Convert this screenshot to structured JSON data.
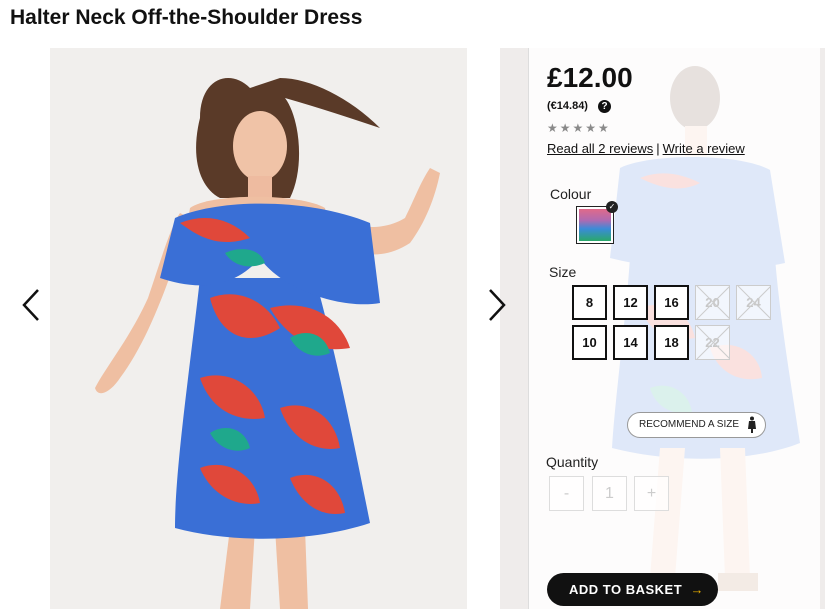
{
  "product": {
    "title": "Halter Neck Off-the-Shoulder Dress",
    "price": "£12.00",
    "price_alt": "(€14.84)",
    "help_icon": "?",
    "stars": "★★★★★",
    "rating": 0,
    "read_reviews": "Read all 2 reviews",
    "separator": "|",
    "write_review": "Write a review"
  },
  "gallery": {
    "prev_icon": "chevron-left-icon",
    "next_icon": "chevron-right-icon"
  },
  "colour": {
    "label": "Colour",
    "selected_check": "✓"
  },
  "size": {
    "label": "Size",
    "options": [
      {
        "value": "8",
        "available": true
      },
      {
        "value": "12",
        "available": true
      },
      {
        "value": "16",
        "available": true
      },
      {
        "value": "20",
        "available": false
      },
      {
        "value": "24",
        "available": false
      },
      {
        "value": "10",
        "available": true
      },
      {
        "value": "14",
        "available": true
      },
      {
        "value": "18",
        "available": true
      },
      {
        "value": "22",
        "available": false
      }
    ],
    "recommend": "RECOMMEND A SIZE"
  },
  "quantity": {
    "label": "Quantity",
    "minus": "-",
    "value": "1",
    "plus": "+"
  },
  "basket": {
    "label": "ADD TO BASKET",
    "arrow": "→"
  },
  "colors": {
    "dress_blue": "#3a6fd6",
    "print_red": "#e0483a",
    "print_teal": "#1fa88c",
    "basket_bg": "#111111",
    "basket_arrow": "#f0b400"
  }
}
